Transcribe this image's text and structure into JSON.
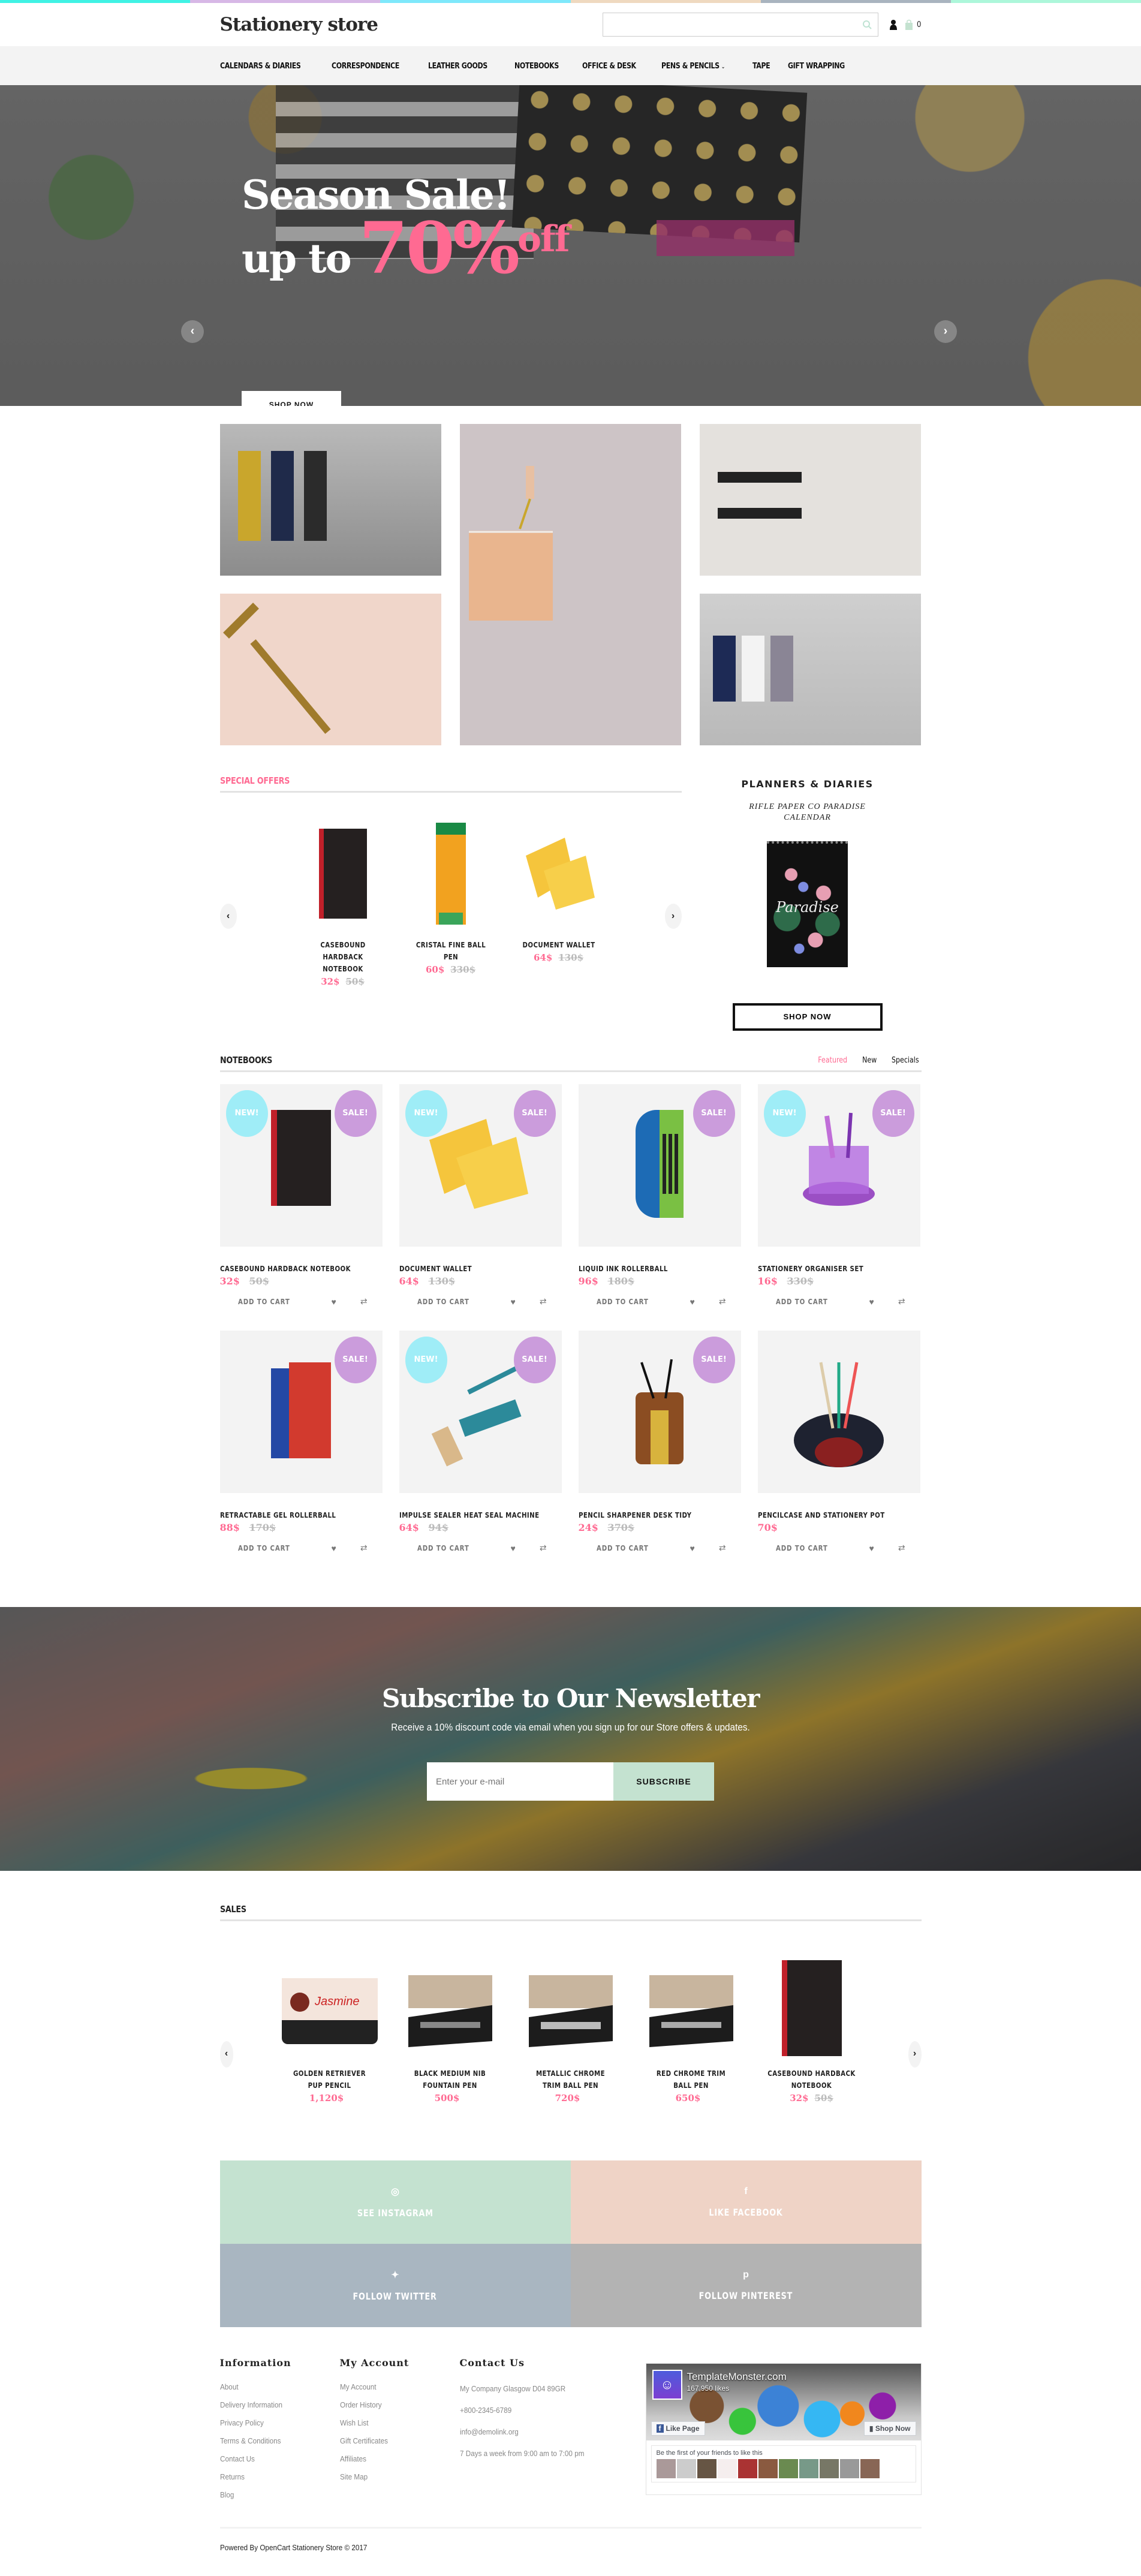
{
  "top_strip_colors": [
    "#40f2e4",
    "#d7b8e6",
    "#7ee8fb",
    "#efd9c0",
    "#a9b4bf",
    "#adf7da"
  ],
  "header": {
    "logo": "Stationery store",
    "search_placeholder": "",
    "cart_count": "0",
    "icons": {
      "search": "search-icon",
      "account": "user-icon",
      "cart": "shopping-bag-icon"
    }
  },
  "nav": {
    "items": [
      {
        "label": "CALENDARS & DIARIES"
      },
      {
        "label": "CORRESPONDENCE"
      },
      {
        "label": "LEATHER GOODS"
      },
      {
        "label": "NOTEBOOKS"
      },
      {
        "label": "OFFICE & DESK"
      },
      {
        "label": "PENS & PENCILS",
        "has_dropdown": true
      },
      {
        "label": "TAPE"
      },
      {
        "label": "GIFT WRAPPING"
      }
    ]
  },
  "hero": {
    "title": "Season Sale!",
    "line2_prefix": "up to",
    "percent": "70%",
    "suffix": "off",
    "button": "SHOP NOW",
    "prev_arrow": "‹",
    "next_arrow": "›"
  },
  "collage": {
    "tiles": [
      {
        "alt": "Yellow, navy and black notebooks"
      },
      {
        "alt": "Leather zip pouch"
      },
      {
        "alt": "Black eraser pens"
      },
      {
        "alt": "Brass pen on pink paper"
      },
      {
        "alt": "Navy, white and grey notebooks"
      }
    ]
  },
  "special_offers": {
    "title": "SPECIAL OFFERS",
    "items": [
      {
        "name": "CASEBOUND HARDBACK NOTEBOOK",
        "price": "32$",
        "old_price": "50$"
      },
      {
        "name": "CRISTAL FINE BALL PEN",
        "price": "60$",
        "old_price": "330$"
      },
      {
        "name": "DOCUMENT WALLET",
        "price": "64$",
        "old_price": "130$"
      }
    ],
    "prev": "‹",
    "next": "›"
  },
  "planners": {
    "title": "PLANNERS & DIARIES",
    "product": "RIFLE PAPER CO PARADISE CALENDAR",
    "calendar_text": "Paradise",
    "button": "SHOP NOW"
  },
  "notebooks": {
    "title": "NOTEBOOKS",
    "tabs": [
      {
        "label": "Featured",
        "active": true
      },
      {
        "label": "New"
      },
      {
        "label": "Specials"
      }
    ],
    "badge_new": "NEW!",
    "badge_sale": "SALE!",
    "add_to_cart": "ADD TO CART",
    "products": [
      {
        "name": "CASEBOUND HARDBACK NOTEBOOK",
        "price": "32$",
        "old_price": "50$",
        "new": true,
        "sale": true
      },
      {
        "name": "DOCUMENT WALLET",
        "price": "64$",
        "old_price": "130$",
        "new": true,
        "sale": true
      },
      {
        "name": "LIQUID INK ROLLERBALL",
        "price": "96$",
        "old_price": "180$",
        "new": false,
        "sale": true
      },
      {
        "name": "STATIONERY ORGANISER SET",
        "price": "16$",
        "old_price": "330$",
        "new": true,
        "sale": true
      },
      {
        "name": "RETRACTABLE GEL ROLLERBALL",
        "price": "88$",
        "old_price": "170$",
        "new": false,
        "sale": true
      },
      {
        "name": "IMPULSE SEALER HEAT SEAL MACHINE",
        "price": "64$",
        "old_price": "94$",
        "new": true,
        "sale": true
      },
      {
        "name": "PENCIL SHARPENER DESK TIDY",
        "price": "24$",
        "old_price": "370$",
        "new": false,
        "sale": true
      },
      {
        "name": "PENCILCASE AND STATIONERY POT",
        "price": "70$",
        "old_price": "",
        "new": false,
        "sale": false
      }
    ]
  },
  "newsletter": {
    "title": "Subscribe to Our Newsletter",
    "subtitle": "Receive a 10% discount code via email when you sign up for our Store offers & updates.",
    "placeholder": "Enter your e-mail",
    "button": "SUBSCRIBE"
  },
  "sales": {
    "title": "SALES",
    "items": [
      {
        "name": "GOLDEN RETRIEVER PUP PENCIL",
        "price": "1,120$",
        "old_price": ""
      },
      {
        "name": "BLACK MEDIUM NIB FOUNTAIN PEN",
        "price": "500$",
        "old_price": ""
      },
      {
        "name": "METALLIC CHROME TRIM BALL PEN",
        "price": "720$",
        "old_price": ""
      },
      {
        "name": "RED CHROME TRIM BALL PEN",
        "price": "650$",
        "old_price": ""
      },
      {
        "name": "CASEBOUND HARDBACK NOTEBOOK",
        "price": "32$",
        "old_price": "50$"
      }
    ],
    "prev": "‹",
    "next": "›"
  },
  "social": [
    {
      "label": "SEE INSTAGRAM",
      "icon": "◎",
      "color": "#c4e2d0"
    },
    {
      "label": "LIKE FACEBOOK",
      "icon": "f",
      "color": "#efd3c6"
    },
    {
      "label": "FOLLOW TWITTER",
      "icon": "🐦",
      "color": "#a9b6c1"
    },
    {
      "label": "FOLLOW PINTEREST",
      "icon": "℗",
      "color": "#b3b3b3"
    }
  ],
  "footer": {
    "information": {
      "title": "Information",
      "links": [
        "About",
        "Delivery Information",
        "Privacy Policy",
        "Terms & Conditions",
        "Contact Us",
        "Returns",
        "Blog"
      ]
    },
    "account": {
      "title": "My Account",
      "links": [
        "My Account",
        "Order History",
        "Wish List",
        "Gift Certificates",
        "Affiliates",
        "Site Map"
      ]
    },
    "contact": {
      "title": "Contact Us",
      "lines": [
        "My Company Glasgow D04 89GR",
        "+800-2345-6789",
        "info@demolink.org",
        "7 Days a week from 9:00 am to 7:00 pm"
      ]
    },
    "facebook": {
      "page_name": "TemplateMonster.com",
      "likes": "167,950 likes",
      "like_button": "Like Page",
      "shop_button": "Shop Now",
      "friends_text": "Be the first of your friends to like this"
    },
    "copyright": "Powered By OpenCart Stationery Store © 2017"
  },
  "colors": {
    "accent_pink": "#ff6a92",
    "badge_new": "#9fedf7",
    "badge_sale": "#cb9cdc",
    "subscribe_green": "#c4e2d0"
  }
}
